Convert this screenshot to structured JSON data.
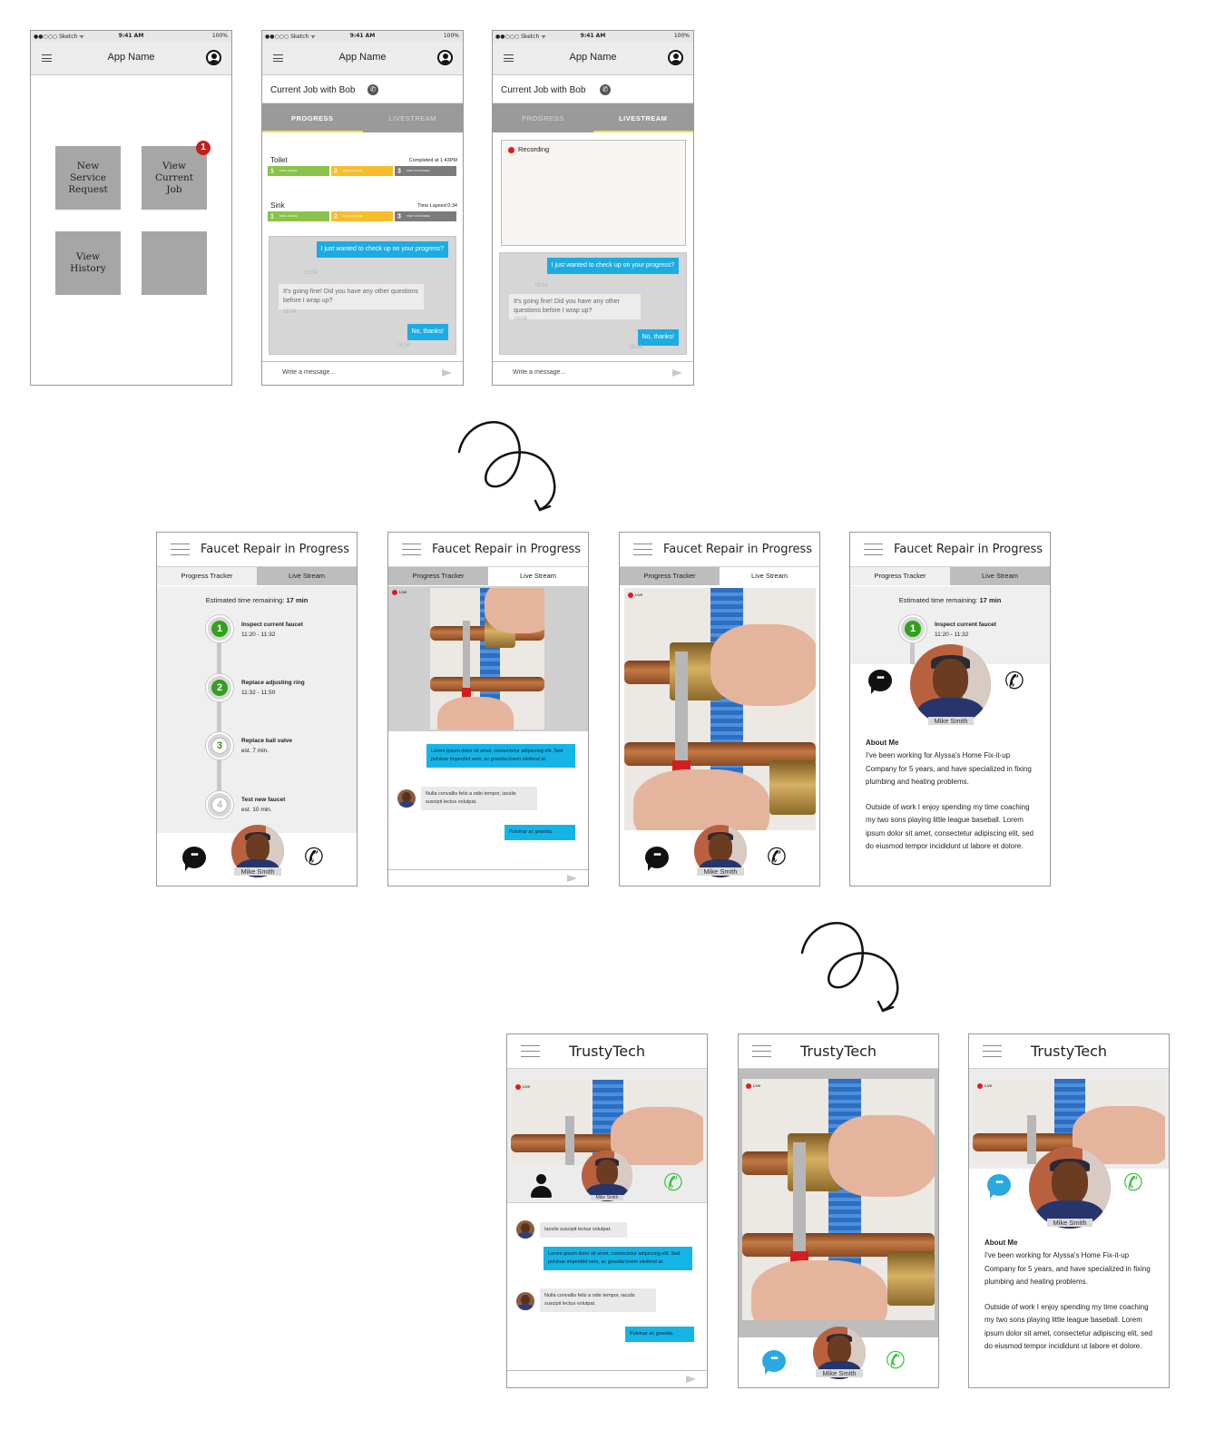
{
  "row1": {
    "status": {
      "carrier": "●●○○○ Sketch ᯤ",
      "time": "9:41 AM",
      "battery": "100%"
    },
    "app_name": "App Name",
    "home": {
      "tiles": [
        "New\nService\nRequest",
        "View\nCurrent\nJob",
        "View\nHistory",
        ""
      ],
      "badge": "1"
    },
    "job_title": "Current Job with Bob",
    "tabs": [
      "PROGRESS",
      "LIVESTREAM"
    ],
    "progress_rows": [
      {
        "name": "Toilet",
        "status": "Completed at 1:43PM",
        "steps": [
          "1",
          "2",
          "3"
        ]
      },
      {
        "name": "Sink",
        "status": "Time Lapsed 0:34",
        "steps": [
          "1",
          "2",
          "3"
        ]
      }
    ],
    "step_tiny": [
      "STEP 1 IS DONE",
      "STEP 2 IS ACTIVE",
      "STEP 3 IS UPCOMING"
    ],
    "recording": "Recording",
    "chat": [
      {
        "from": "me",
        "text": "I just wanted to check up on your progress?",
        "time": "18:04"
      },
      {
        "from": "them",
        "text": "It's going fine! Did you have any other questions before I wrap up?",
        "time": "18:04"
      },
      {
        "from": "me",
        "text": "No, thanks!",
        "time": "18:04"
      }
    ],
    "input_placeholder": "Write a message..."
  },
  "row2": {
    "title": "Faucet Repair in Progress",
    "tabs": [
      "Progress Tracker",
      "Live Stream"
    ],
    "est_label": "Estimated time remaining: ",
    "est_value": "17 min",
    "steps": [
      {
        "n": "1",
        "title": "Inspect current faucet",
        "sub": "11:20 - 11:32"
      },
      {
        "n": "2",
        "title": "Replace adjusting ring",
        "sub": "11:32 - 11:50"
      },
      {
        "n": "3",
        "title": "Replace ball valve",
        "sub": "est. 7 min."
      },
      {
        "n": "4",
        "title": "Test new faucet",
        "sub": "est. 10 min."
      }
    ],
    "tech_name": "Mike Smith",
    "live": "Live",
    "chat": [
      {
        "from": "me",
        "text": "Lorem ipsum dolor sit amet, consectetur adipiscing elit. Sed pulvinar imperdiet sem, ac gravida lorem eleifend at."
      },
      {
        "from": "them",
        "text": "Nulla convallis felis a odio tempor, iaculis suscipit lectus volutpat."
      },
      {
        "from": "me",
        "text": "Pulvinar ac gravida."
      }
    ],
    "about_title": "About Me",
    "about_p1": "I've been working for Alyssa's Home Fix-it-up Company for 5 years, and have specialized in fixing plumbing and heating problems.",
    "about_p2": "Outside of work I enjoy spending my time coaching my two sons playing little league baseball. Lorem ipsum dolor sit amet, consectetur adipiscing elit, sed do eiusmod tempor incididunt ut labore et dolore."
  },
  "row3": {
    "title": "TrustyTech",
    "chat": [
      {
        "from": "them",
        "text": "Iaculis suscipit lectus volutpat."
      },
      {
        "from": "me",
        "text": "Lorem ipsum dolor sit amet, consectetur adipiscing elit. Sed pulvinar imperdiet sem, ac gravida lorem eleifend at."
      },
      {
        "from": "them",
        "text": "Nulla convallis felis a odio tempor, iaculis suscipit lectus volutpat."
      },
      {
        "from": "me",
        "text": "Pulvinar ac gravida."
      }
    ]
  },
  "colors": {
    "accent_blue": "#1dace1",
    "step_green": "#33a01e",
    "call_green": "#3cc442",
    "badge_red": "#c0201a"
  }
}
